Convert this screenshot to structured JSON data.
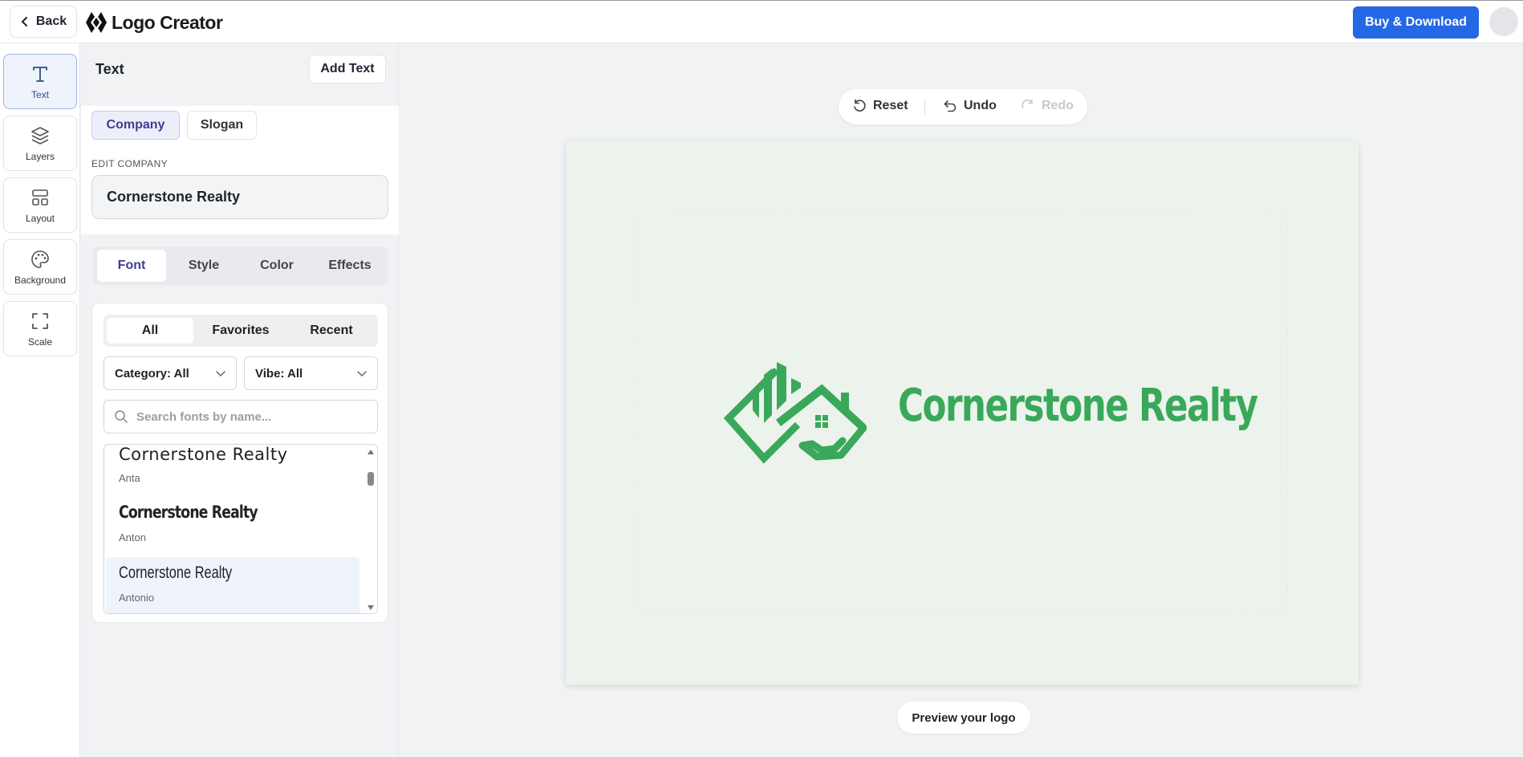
{
  "header": {
    "back_label": "Back",
    "brand_name": "Logo Creator",
    "buy_label": "Buy & Download"
  },
  "rail": {
    "items": [
      {
        "label": "Text",
        "icon": "text-icon",
        "active": true
      },
      {
        "label": "Layers",
        "icon": "layers-icon"
      },
      {
        "label": "Layout",
        "icon": "layout-icon"
      },
      {
        "label": "Background",
        "icon": "palette-icon"
      },
      {
        "label": "Scale",
        "icon": "scale-icon"
      }
    ]
  },
  "panel": {
    "title": "Text",
    "add_text_label": "Add Text",
    "text_tabs": [
      {
        "label": "Company",
        "active": true
      },
      {
        "label": "Slogan"
      }
    ],
    "edit_label": "EDIT COMPANY",
    "edit_value": "Cornerstone Realty",
    "style_tabs": [
      {
        "label": "Font",
        "active": true
      },
      {
        "label": "Style"
      },
      {
        "label": "Color"
      },
      {
        "label": "Effects"
      }
    ],
    "filter_tabs": [
      {
        "label": "All",
        "active": true
      },
      {
        "label": "Favorites"
      },
      {
        "label": "Recent"
      }
    ],
    "category_dropdown": "Category: All",
    "vibe_dropdown": "Vibe: All",
    "search_placeholder": "Search fonts by name...",
    "fonts": [
      {
        "sample": "Cornerstone Realty",
        "name": "Anta"
      },
      {
        "sample": "Cornerstone Realty",
        "name": "Anton"
      },
      {
        "sample": "Cornerstone Realty",
        "name": "Antonio",
        "selected": true
      }
    ]
  },
  "history": {
    "reset_label": "Reset",
    "undo_label": "Undo",
    "redo_label": "Redo"
  },
  "canvas": {
    "logo_text": "Cornerstone Realty",
    "logo_color": "#3aa85a",
    "background_color": "#ecf3ec"
  },
  "preview_label": "Preview your logo",
  "colors": {
    "accent": "#2468e5",
    "active_tab_text": "#3d3f8f"
  }
}
